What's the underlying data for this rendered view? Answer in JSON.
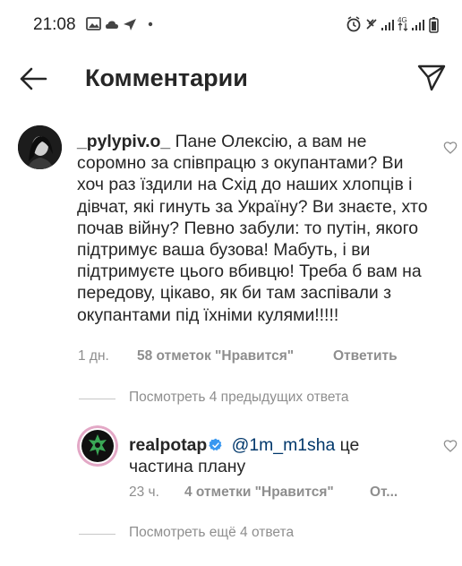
{
  "status_bar": {
    "time": "21:08",
    "right_text": "4G"
  },
  "header": {
    "title": "Комментарии"
  },
  "comments": [
    {
      "username": "_pylypiv.o_",
      "text": "Пане Олексію, а вам не соромно за співпрацю з окупантами? Ви хоч раз їздили на Схід до наших хлопців і дівчат, які гинуть за Україну? Ви знаєте, хто почав війну? Певно забули: то путін, якого підтримує ваша бузова! Мабуть, і ви підтримуєте цього вбивцю! Треба б вам на передову, цікаво, як би там заспівали з окупантами під їхніми кулями!!!!!",
      "time": "1 дн.",
      "likes": "58 отметок \"Нравится\"",
      "reply_label": "Ответить"
    }
  ],
  "view_previous": "Посмотреть 4 предыдущих ответа",
  "reply": {
    "username": "realpotap",
    "mention": "@1m_m1sha",
    "text": "це частина плану",
    "time": "23 ч.",
    "likes": "4 отметки \"Нравится\"",
    "reply_label": "От..."
  },
  "view_more": "Посмотреть ещё 4 ответа",
  "colors": {
    "text": "#262626",
    "secondary": "#8e8e8e",
    "mention": "#00376b",
    "verified": "#3897f0"
  },
  "icons": [
    "back-arrow-icon",
    "send-icon",
    "heart-icon",
    "verified-badge-icon"
  ]
}
